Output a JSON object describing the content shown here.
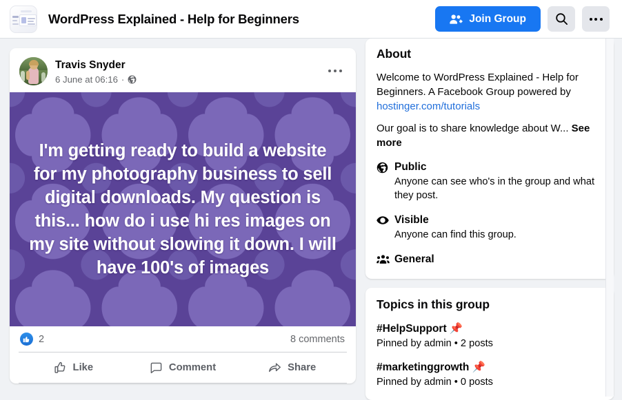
{
  "header": {
    "group_title": "WordPress Explained - Help for Beginners",
    "join_label": "Join Group",
    "avatar_alt": "group-thumbnail",
    "accent_blue": "#1877f2",
    "button_bg": "#e4e6eb"
  },
  "post": {
    "author": "Travis Snyder",
    "timestamp": "6 June at 06:16",
    "separator": "·",
    "privacy_icon": "globe-icon",
    "image_text": "I'm getting ready to build a website for my photography business to sell digital downloads. My question is this... how do i use hi res images on my site without slowing it down. I will have 100's of images",
    "image_bg_color": "#5a4397",
    "image_pattern_color": "#7966b8",
    "reaction_count": "2",
    "comment_count": "8 comments",
    "actions": [
      {
        "label": "Like",
        "icon": "thumbs-up-icon"
      },
      {
        "label": "Comment",
        "icon": "comment-bubble-icon"
      },
      {
        "label": "Share",
        "icon": "share-arrow-icon"
      }
    ]
  },
  "about": {
    "title": "About",
    "description_before": "Welcome to WordPress Explained - Help for Beginners. A Facebook Group powered by ",
    "link_text": "hostinger.com/tutorials",
    "goal_text": "Our goal is to share knowledge about W... ",
    "see_more": "See more",
    "info_rows": [
      {
        "icon": "globe-icon",
        "label": "Public",
        "sub": "Anyone can see who's in the group and what they post."
      },
      {
        "icon": "eye-icon",
        "label": "Visible",
        "sub": "Anyone can find this group."
      },
      {
        "icon": "people-group-icon",
        "label": "General",
        "sub": ""
      }
    ]
  },
  "topics": {
    "title": "Topics in this group",
    "items": [
      {
        "name": "#HelpSupport 📌",
        "sub": "Pinned by admin • 2 posts"
      },
      {
        "name": "#marketinggrowth 📌",
        "sub": "Pinned by admin • 0 posts"
      }
    ]
  }
}
